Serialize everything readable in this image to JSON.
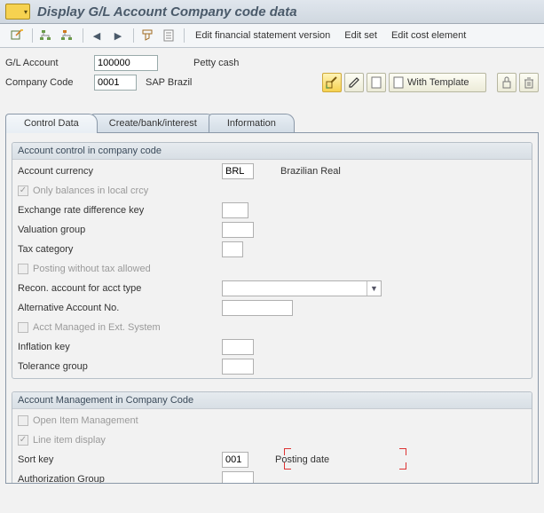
{
  "title": "Display G/L Account Company code data",
  "toolbar_links": {
    "edit_fsv": "Edit financial statement version",
    "edit_set": "Edit set",
    "edit_cost_el": "Edit cost element"
  },
  "selection": {
    "gl_account_label": "G/L Account",
    "gl_account_value": "100000",
    "gl_account_desc": "Petty cash",
    "company_code_label": "Company Code",
    "company_code_value": "0001",
    "company_code_desc": "SAP Brazil",
    "with_template_label": "With Template"
  },
  "tabs": {
    "control_data": "Control Data",
    "create_bank": "Create/bank/interest",
    "information": "Information"
  },
  "group1": {
    "title": "Account control in company code",
    "account_currency_label": "Account currency",
    "account_currency_value": "BRL",
    "account_currency_desc": "Brazilian Real",
    "only_balances_label": "Only balances in local crcy",
    "exch_rate_label": "Exchange rate difference key",
    "valuation_group_label": "Valuation group",
    "tax_category_label": "Tax category",
    "posting_without_tax_label": "Posting without tax allowed",
    "recon_account_label": "Recon. account for acct type",
    "alt_account_label": "Alternative Account No.",
    "acct_managed_ext_label": "Acct Managed in Ext. System",
    "inflation_key_label": "Inflation key",
    "tolerance_group_label": "Tolerance group"
  },
  "group2": {
    "title": "Account Management in Company Code",
    "open_item_label": "Open Item Management",
    "line_item_label": "Line item display",
    "sort_key_label": "Sort key",
    "sort_key_value": "001",
    "sort_key_desc": "Posting date",
    "auth_group_label": "Authorization Group"
  }
}
